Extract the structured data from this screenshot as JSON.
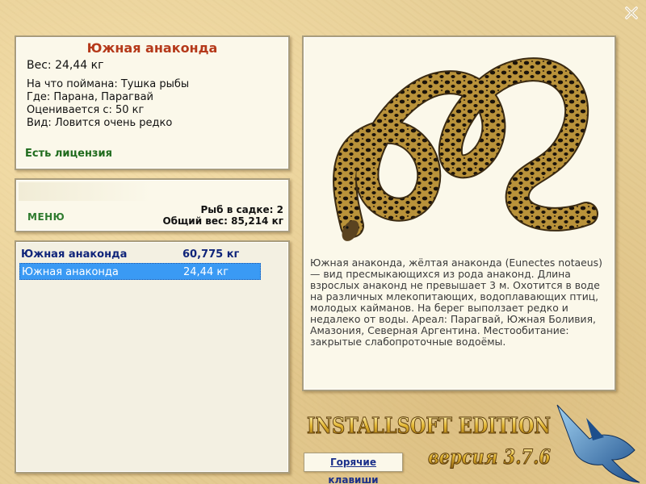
{
  "info": {
    "title": "Южная анаконда",
    "weight": "Вес: 24,44 кг",
    "details": [
      "На что поймана: Тушка рыбы",
      "Где: Парана, Парагвай",
      "Оценивается с: 50 кг",
      "Вид: Ловится очень редко"
    ],
    "license": "Есть лицензия"
  },
  "menu": {
    "label": "МЕНЮ",
    "fish_in_net": "Рыб в садке: 2",
    "total_weight": "Общий вес: 85,214 кг"
  },
  "catch_list": [
    {
      "name": "Южная анаконда",
      "weight": "60,775 кг"
    },
    {
      "name": "Южная анаконда",
      "weight": "24,44 кг"
    }
  ],
  "description": "Южная анаконда, жёлтая анаконда (Eunectes notaeus) — вид пресмыкающихся из рода анаконд. Длина взрослых анаконд не превышает 3 м. Охотится в воде на различных млекопитающих, водоплавающих птиц, молодых кайманов. На берег выползает редко и недалеко от воды. Ареал: Парагвай, Южная Боливия, Амазония, Северная Аргентина. Местообитание: закрытые слабопроточные водоёмы.",
  "buttons": {
    "hotkeys": "Горячие клавиши"
  },
  "brand": {
    "name": "INSTALLSOFT EDITION",
    "version": "версия 3.7.6"
  },
  "icons": {
    "close": "close-icon",
    "snake": "anaconda-photo",
    "logo": "marlin-fish-logo"
  },
  "colors": {
    "title": "#b5391a",
    "license": "#1f6b1d",
    "selection": "#3a9af4",
    "list_header": "#10257a",
    "panel_bg": "#fbf8ea"
  }
}
